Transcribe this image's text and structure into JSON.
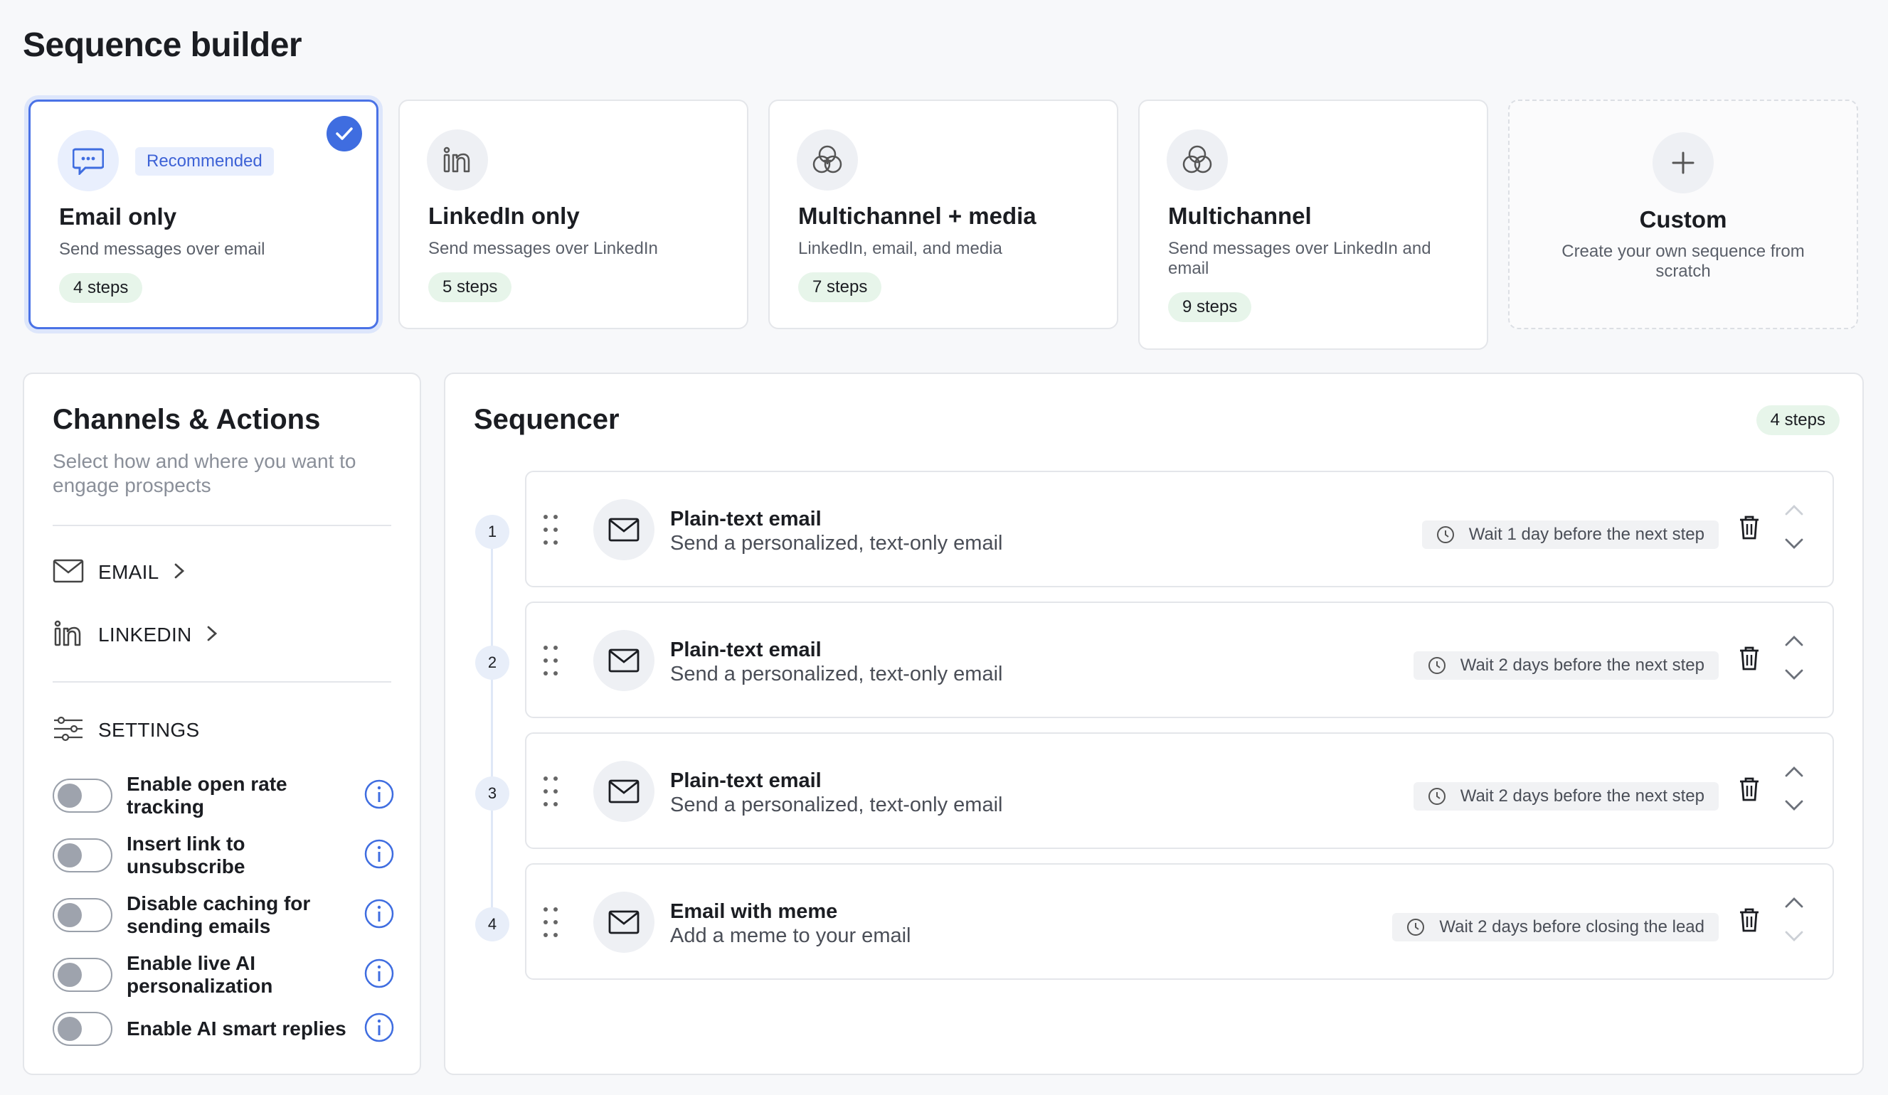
{
  "page": {
    "title": "Sequence builder"
  },
  "templates": [
    {
      "title": "Email only",
      "description": "Send messages over email",
      "steps": "4 steps",
      "badge": "Recommended",
      "selected": true,
      "icon": "chat-bubble-icon"
    },
    {
      "title": "LinkedIn only",
      "description": "Send messages over LinkedIn",
      "steps": "5 steps",
      "icon": "linkedin-icon"
    },
    {
      "title": "Multichannel + media",
      "description": "LinkedIn, email, and media",
      "steps": "7 steps",
      "icon": "multichannel-plus-icon"
    },
    {
      "title": "Multichannel",
      "description": "Send messages over LinkedIn and email",
      "steps": "9 steps",
      "icon": "multichannel-icon"
    },
    {
      "title": "Custom",
      "description": "Create your own sequence from scratch",
      "icon": "plus-icon"
    }
  ],
  "channels": {
    "title": "Channels & Actions",
    "subtitle": "Select how and where you want to engage prospects",
    "nav": [
      {
        "label": "EMAIL",
        "icon": "envelope-icon"
      },
      {
        "label": "LINKEDIN",
        "icon": "linkedin-icon"
      }
    ],
    "settings_label": "SETTINGS",
    "settings": [
      {
        "label": "Enable open rate tracking",
        "enabled": false
      },
      {
        "label": "Insert link to unsubscribe",
        "enabled": false
      },
      {
        "label": "Disable caching for sending emails",
        "enabled": false
      },
      {
        "label": "Enable live AI personalization",
        "enabled": false
      },
      {
        "label": "Enable AI smart replies",
        "enabled": false
      }
    ]
  },
  "sequencer": {
    "title": "Sequencer",
    "count": "4 steps",
    "steps": [
      {
        "number": "1",
        "title": "Plain-text email",
        "description": "Send a personalized, text-only email",
        "wait": "Wait 1 day before the next step"
      },
      {
        "number": "2",
        "title": "Plain-text email",
        "description": "Send a personalized, text-only email",
        "wait": "Wait 2 days before the next step"
      },
      {
        "number": "3",
        "title": "Plain-text email",
        "description": "Send a personalized, text-only email",
        "wait": "Wait 2 days before the next step"
      },
      {
        "number": "4",
        "title": "Email with meme",
        "description": "Add a meme to your email",
        "wait": "Wait 2 days before closing the lead"
      }
    ]
  },
  "colors": {
    "accent": "#3f6de0",
    "pill_bg": "#e7f5ea",
    "border": "#e4e6ea"
  }
}
